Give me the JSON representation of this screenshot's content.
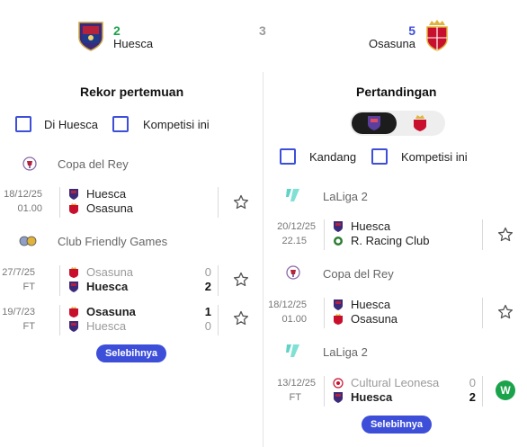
{
  "header": {
    "home": {
      "name": "Huesca",
      "wins": "2",
      "logo_icon": "huesca-crest-icon"
    },
    "draws": "3",
    "away": {
      "name": "Osasuna",
      "wins": "5",
      "logo_icon": "osasuna-crest-icon"
    }
  },
  "left": {
    "title": "Rekor pertemuan",
    "filters": [
      {
        "label": "Di Huesca",
        "checked": false
      },
      {
        "label": "Kompetisi ini",
        "checked": false
      }
    ],
    "groups": [
      {
        "competition": "Copa del Rey",
        "icon": "copa-del-rey-icon",
        "matches": [
          {
            "date": "18/12/25",
            "time": "01.00",
            "home": "Huesca",
            "away": "Osasuna"
          }
        ]
      },
      {
        "competition": "Club Friendly Games",
        "icon": "club-friendly-icon",
        "matches": [
          {
            "date": "27/7/25",
            "time": "FT",
            "home": "Osasuna",
            "away": "Huesca",
            "home_score": "0",
            "away_score": "2"
          },
          {
            "date": "19/7/23",
            "time": "FT",
            "home": "Osasuna",
            "away": "Huesca",
            "home_score": "1",
            "away_score": "0"
          }
        ]
      }
    ],
    "more_label": "Selebihnya"
  },
  "right": {
    "title": "Pertandingan",
    "toggle": {
      "active": "Huesca",
      "options": [
        "Huesca",
        "Osasuna"
      ]
    },
    "filters": [
      {
        "label": "Kandang",
        "checked": false
      },
      {
        "label": "Kompetisi ini",
        "checked": false
      }
    ],
    "groups": [
      {
        "competition": "LaLiga 2",
        "icon": "laliga-2-icon",
        "matches": [
          {
            "date": "20/12/25",
            "time": "22.15",
            "home": "Huesca",
            "away": "R. Racing Club"
          }
        ]
      },
      {
        "competition": "Copa del Rey",
        "icon": "copa-del-rey-icon",
        "matches": [
          {
            "date": "18/12/25",
            "time": "01.00",
            "home": "Huesca",
            "away": "Osasuna"
          }
        ]
      },
      {
        "competition": "LaLiga 2",
        "icon": "laliga-2-icon",
        "matches": [
          {
            "date": "13/12/25",
            "time": "FT",
            "home": "Cultural Leonesa",
            "away": "Huesca",
            "home_score": "0",
            "away_score": "2",
            "result": "W"
          }
        ]
      }
    ],
    "more_label": "Selebihnya"
  },
  "colors": {
    "accent": "#3d4fd9",
    "win": "#1aa34a",
    "draw": "#9a9a9a"
  }
}
